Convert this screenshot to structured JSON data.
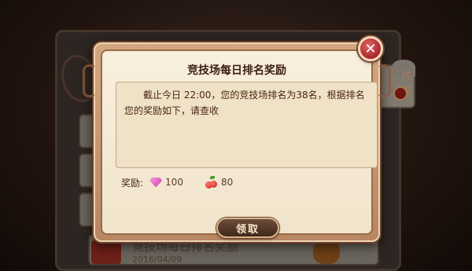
{
  "background": {
    "right_tab_text": "件\n给",
    "mail_title": "竞技场每日排名奖励",
    "mail_date": "2016/04/09"
  },
  "dialog": {
    "title": "竞技场每日排名奖励",
    "message": "截止今日 22:00，您的竞技场排名为38名，根据排名您的奖励如下，请查收",
    "reward_label": "奖励:",
    "rewards": [
      {
        "icon": "pink-gem-icon",
        "value": "100"
      },
      {
        "icon": "cherry-icon",
        "value": "80"
      }
    ],
    "receive_button": "领取",
    "close_icon": "close-x-icon"
  },
  "colors": {
    "title": "#3b1e10",
    "text": "#4a2514",
    "close": "#a6272a",
    "frame": "#b88662"
  }
}
